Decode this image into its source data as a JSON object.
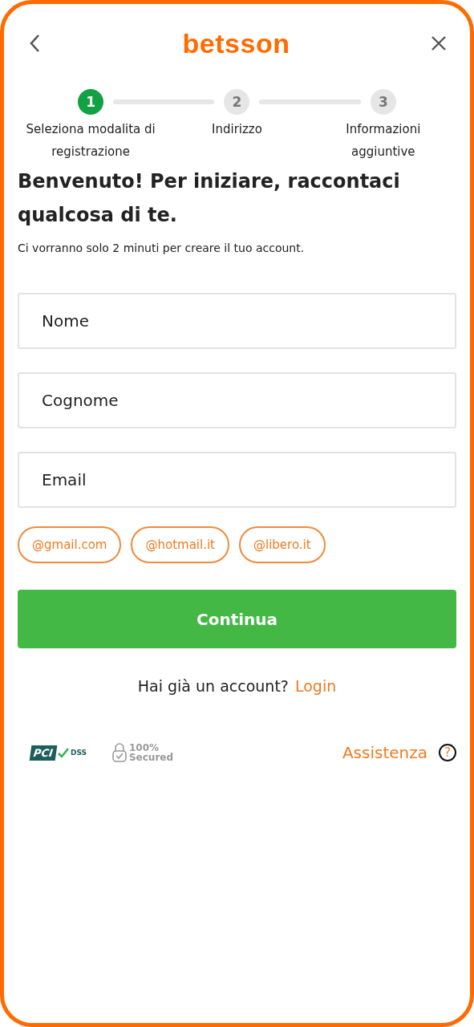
{
  "header": {
    "logo": "betsson"
  },
  "steps": [
    {
      "number": "1",
      "label": "Seleziona modalita di registrazione",
      "selected": true
    },
    {
      "number": "2",
      "label": "Indirizzo",
      "selected": false
    },
    {
      "number": "3",
      "label": "Informazioni aggiuntive",
      "selected": false
    }
  ],
  "title": "Benvenuto! Per iniziare, raccontaci qualcosa di te.",
  "subtitle": "Ci vorranno solo 2 minuti per creare il tuo account.",
  "fields": [
    {
      "placeholder": "Nome"
    },
    {
      "placeholder": "Cognome"
    },
    {
      "placeholder": "Email"
    }
  ],
  "email_suggestions": [
    "@gmail.com",
    "@hotmail.it",
    "@libero.it"
  ],
  "submit_button": "Continua",
  "login_prompt": {
    "text": "Hai già un account?",
    "link": "Login"
  },
  "footer": {
    "pci_badge": {
      "mark": "PCI",
      "text": "DSS"
    },
    "secured_badge": {
      "line_1": "100%",
      "line_2": "Secured"
    },
    "help_link": "Assistenza",
    "help_icon": "?"
  }
}
